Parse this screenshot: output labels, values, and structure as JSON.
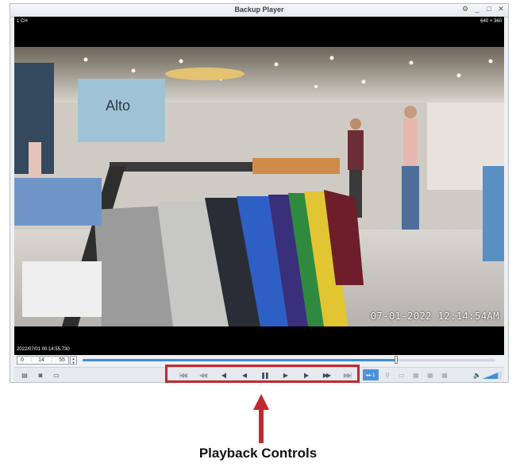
{
  "window": {
    "title": "Backup Player",
    "controls": [
      "gear-icon",
      "minimize-icon",
      "maximize-icon",
      "close-icon"
    ]
  },
  "video": {
    "channel_label": "1 CH",
    "resolution_label": "640 × 360",
    "overlay_timestamp": "07-01-2022  12:14:54AM",
    "bottom_timestamp": "2022/07/01 00:14:55.730"
  },
  "seek": {
    "time_hours": "0",
    "time_minutes": "14",
    "time_seconds": "55",
    "progress": 0.76
  },
  "toolbar": {
    "left_icons": [
      "export-icon",
      "snapshot-icon",
      "print-icon"
    ],
    "playback": [
      {
        "icon": "skip-to-start-icon"
      },
      {
        "icon": "fast-reverse-icon"
      },
      {
        "icon": "step-back-frame-icon"
      },
      {
        "icon": "play-reverse-icon"
      },
      {
        "icon": "pause-icon"
      },
      {
        "icon": "play-icon"
      },
      {
        "icon": "step-forward-frame-icon"
      },
      {
        "icon": "fast-forward-icon"
      },
      {
        "icon": "skip-to-end-icon"
      }
    ],
    "speed_label": "▸▸ 1",
    "right_icons": [
      "zoom-icon",
      "layout-1-icon",
      "layout-4-icon",
      "layout-9-icon",
      "layout-16-icon"
    ],
    "volume_icon": "speaker-icon",
    "volume_level": 0.8
  },
  "annotation": {
    "caption": "Playback Controls",
    "accent_color": "#c0292d"
  }
}
